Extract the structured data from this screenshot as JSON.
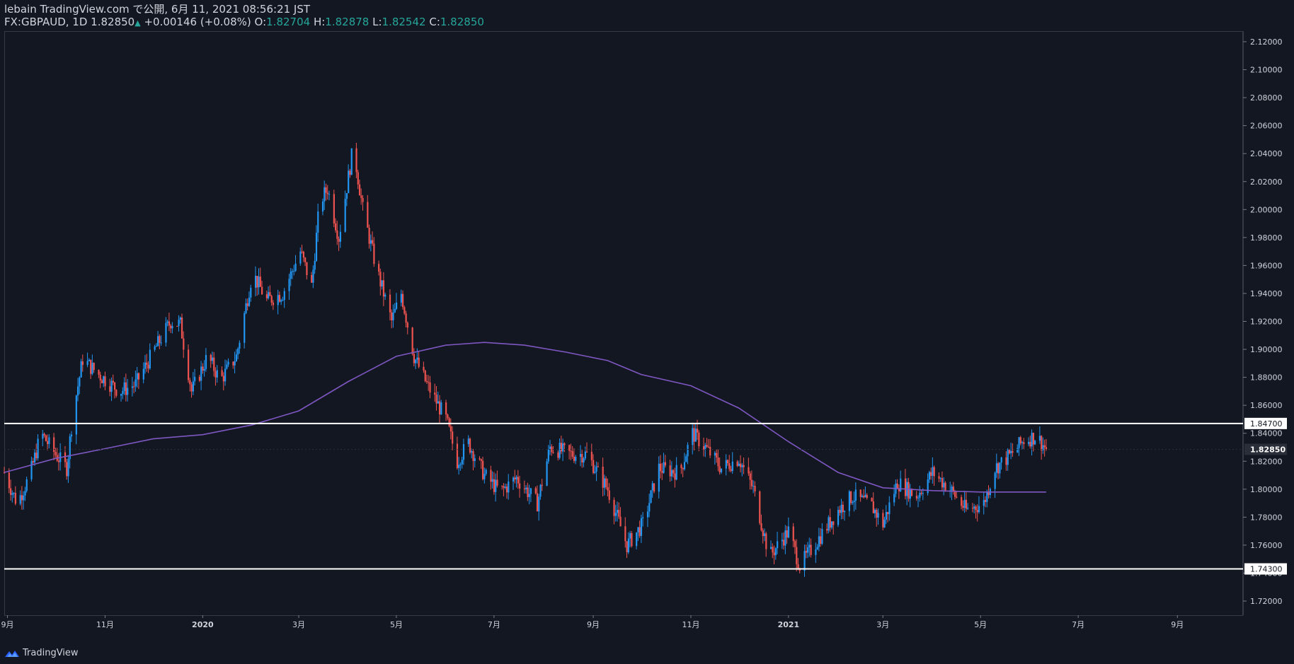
{
  "header": {
    "publisher": "lebain TradingView.com で公開, 6月 11, 2021 08:56:21 JST",
    "symbol": "FX:GBPAUD, 1D",
    "last": "1.82850",
    "change_arrow": "▲",
    "change": "+0.00146 (+0.08%)",
    "o_label": "O:",
    "o_value": "1.82704",
    "h_label": "H:",
    "h_value": "1.82878",
    "l_label": "L:",
    "l_value": "1.82542",
    "c_label": "C:",
    "c_value": "1.82850"
  },
  "footer": {
    "brand": "TradingView",
    "logo_icon": "tradingview-logo-icon"
  },
  "chart_data": {
    "type": "candlestick",
    "ylim": [
      1.71,
      2.125
    ],
    "y_ticks": [
      "2.12000",
      "2.10000",
      "2.08000",
      "2.06000",
      "2.04000",
      "2.02000",
      "2.00000",
      "1.98000",
      "1.96000",
      "1.94000",
      "1.92000",
      "1.90000",
      "1.88000",
      "1.86000",
      "1.84000",
      "1.82000",
      "1.80000",
      "1.78000",
      "1.76000",
      "1.74000",
      "1.72000"
    ],
    "x_ticks": [
      {
        "label": "9月",
        "date": "2019-09-01"
      },
      {
        "label": "11月",
        "date": "2019-11-01"
      },
      {
        "label": "2020",
        "date": "2020-01-01"
      },
      {
        "label": "3月",
        "date": "2020-03-01"
      },
      {
        "label": "5月",
        "date": "2020-05-01"
      },
      {
        "label": "7月",
        "date": "2020-07-01"
      },
      {
        "label": "9月",
        "date": "2020-09-01"
      },
      {
        "label": "11月",
        "date": "2020-11-01"
      },
      {
        "label": "2021",
        "date": "2021-01-01"
      },
      {
        "label": "3月",
        "date": "2021-03-01"
      },
      {
        "label": "5月",
        "date": "2021-05-01"
      },
      {
        "label": "7月",
        "date": "2021-07-01"
      },
      {
        "label": "9月",
        "date": "2021-09-01"
      }
    ],
    "xlim": [
      "2019-08-30",
      "2021-10-12"
    ],
    "horizontal_lines": [
      {
        "value": 1.847,
        "label": "1.84700",
        "color": "#ffffff"
      },
      {
        "value": 1.743,
        "label": "1.74300",
        "color": "#ffffff"
      }
    ],
    "last_price": {
      "value": 1.8285,
      "label": "1.82850"
    },
    "colors": {
      "up": "#2196f3",
      "down": "#ef5350",
      "ma": "#7e57c2",
      "background": "#131722",
      "grid_text": "#d1d4dc"
    },
    "moving_average": [
      {
        "date": "2019-08-30",
        "value": 1.812
      },
      {
        "date": "2019-10-01",
        "value": 1.822
      },
      {
        "date": "2019-11-01",
        "value": 1.829
      },
      {
        "date": "2019-12-01",
        "value": 1.836
      },
      {
        "date": "2020-01-01",
        "value": 1.839
      },
      {
        "date": "2020-02-01",
        "value": 1.846
      },
      {
        "date": "2020-03-01",
        "value": 1.856
      },
      {
        "date": "2020-04-01",
        "value": 1.877
      },
      {
        "date": "2020-05-01",
        "value": 1.895
      },
      {
        "date": "2020-06-01",
        "value": 1.903
      },
      {
        "date": "2020-06-25",
        "value": 1.905
      },
      {
        "date": "2020-07-20",
        "value": 1.903
      },
      {
        "date": "2020-08-15",
        "value": 1.898
      },
      {
        "date": "2020-09-10",
        "value": 1.892
      },
      {
        "date": "2020-10-01",
        "value": 1.882
      },
      {
        "date": "2020-11-01",
        "value": 1.874
      },
      {
        "date": "2020-12-01",
        "value": 1.858
      },
      {
        "date": "2021-01-01",
        "value": 1.834
      },
      {
        "date": "2021-02-01",
        "value": 1.812
      },
      {
        "date": "2021-03-01",
        "value": 1.801
      },
      {
        "date": "2021-04-01",
        "value": 1.799
      },
      {
        "date": "2021-05-01",
        "value": 1.798
      },
      {
        "date": "2021-06-11",
        "value": 1.798
      }
    ],
    "price_path": [
      {
        "date": "2019-08-30",
        "value": 1.812
      },
      {
        "date": "2019-09-07",
        "value": 1.79
      },
      {
        "date": "2019-09-15",
        "value": 1.81
      },
      {
        "date": "2019-09-22",
        "value": 1.84
      },
      {
        "date": "2019-10-01",
        "value": 1.825
      },
      {
        "date": "2019-10-08",
        "value": 1.815
      },
      {
        "date": "2019-10-12",
        "value": 1.855
      },
      {
        "date": "2019-10-18",
        "value": 1.893
      },
      {
        "date": "2019-10-28",
        "value": 1.882
      },
      {
        "date": "2019-11-10",
        "value": 1.87
      },
      {
        "date": "2019-11-20",
        "value": 1.875
      },
      {
        "date": "2019-12-01",
        "value": 1.898
      },
      {
        "date": "2019-12-12",
        "value": 1.92
      },
      {
        "date": "2019-12-18",
        "value": 1.918
      },
      {
        "date": "2019-12-25",
        "value": 1.87
      },
      {
        "date": "2020-01-04",
        "value": 1.895
      },
      {
        "date": "2020-01-12",
        "value": 1.878
      },
      {
        "date": "2020-01-22",
        "value": 1.895
      },
      {
        "date": "2020-02-01",
        "value": 1.955
      },
      {
        "date": "2020-02-10",
        "value": 1.935
      },
      {
        "date": "2020-02-20",
        "value": 1.94
      },
      {
        "date": "2020-03-02",
        "value": 1.97
      },
      {
        "date": "2020-03-09",
        "value": 1.945
      },
      {
        "date": "2020-03-14",
        "value": 2.005
      },
      {
        "date": "2020-03-19",
        "value": 2.015
      },
      {
        "date": "2020-03-26",
        "value": 1.98
      },
      {
        "date": "2020-04-04",
        "value": 2.045
      },
      {
        "date": "2020-04-10",
        "value": 2.0
      },
      {
        "date": "2020-04-18",
        "value": 1.96
      },
      {
        "date": "2020-04-28",
        "value": 1.92
      },
      {
        "date": "2020-05-04",
        "value": 1.94
      },
      {
        "date": "2020-05-12",
        "value": 1.895
      },
      {
        "date": "2020-05-20",
        "value": 1.875
      },
      {
        "date": "2020-06-01",
        "value": 1.85
      },
      {
        "date": "2020-06-08",
        "value": 1.82
      },
      {
        "date": "2020-06-15",
        "value": 1.833
      },
      {
        "date": "2020-06-25",
        "value": 1.81
      },
      {
        "date": "2020-07-05",
        "value": 1.798
      },
      {
        "date": "2020-07-15",
        "value": 1.808
      },
      {
        "date": "2020-07-28",
        "value": 1.79
      },
      {
        "date": "2020-08-05",
        "value": 1.83
      },
      {
        "date": "2020-08-18",
        "value": 1.825
      },
      {
        "date": "2020-08-28",
        "value": 1.825
      },
      {
        "date": "2020-09-10",
        "value": 1.8
      },
      {
        "date": "2020-09-22",
        "value": 1.76
      },
      {
        "date": "2020-10-02",
        "value": 1.775
      },
      {
        "date": "2020-10-12",
        "value": 1.815
      },
      {
        "date": "2020-10-25",
        "value": 1.812
      },
      {
        "date": "2020-11-02",
        "value": 1.84
      },
      {
        "date": "2020-11-10",
        "value": 1.83
      },
      {
        "date": "2020-11-20",
        "value": 1.815
      },
      {
        "date": "2020-12-01",
        "value": 1.822
      },
      {
        "date": "2020-12-10",
        "value": 1.8
      },
      {
        "date": "2020-12-20",
        "value": 1.752
      },
      {
        "date": "2021-01-01",
        "value": 1.77
      },
      {
        "date": "2021-01-08",
        "value": 1.745
      },
      {
        "date": "2021-01-20",
        "value": 1.765
      },
      {
        "date": "2021-02-01",
        "value": 1.785
      },
      {
        "date": "2021-02-10",
        "value": 1.795
      },
      {
        "date": "2021-02-22",
        "value": 1.788
      },
      {
        "date": "2021-03-01",
        "value": 1.775
      },
      {
        "date": "2021-03-10",
        "value": 1.805
      },
      {
        "date": "2021-03-22",
        "value": 1.795
      },
      {
        "date": "2021-04-01",
        "value": 1.812
      },
      {
        "date": "2021-04-12",
        "value": 1.8
      },
      {
        "date": "2021-04-22",
        "value": 1.785
      },
      {
        "date": "2021-05-03",
        "value": 1.79
      },
      {
        "date": "2021-05-10",
        "value": 1.815
      },
      {
        "date": "2021-05-20",
        "value": 1.825
      },
      {
        "date": "2021-05-28",
        "value": 1.835
      },
      {
        "date": "2021-06-05",
        "value": 1.838
      },
      {
        "date": "2021-06-11",
        "value": 1.8285
      }
    ]
  }
}
